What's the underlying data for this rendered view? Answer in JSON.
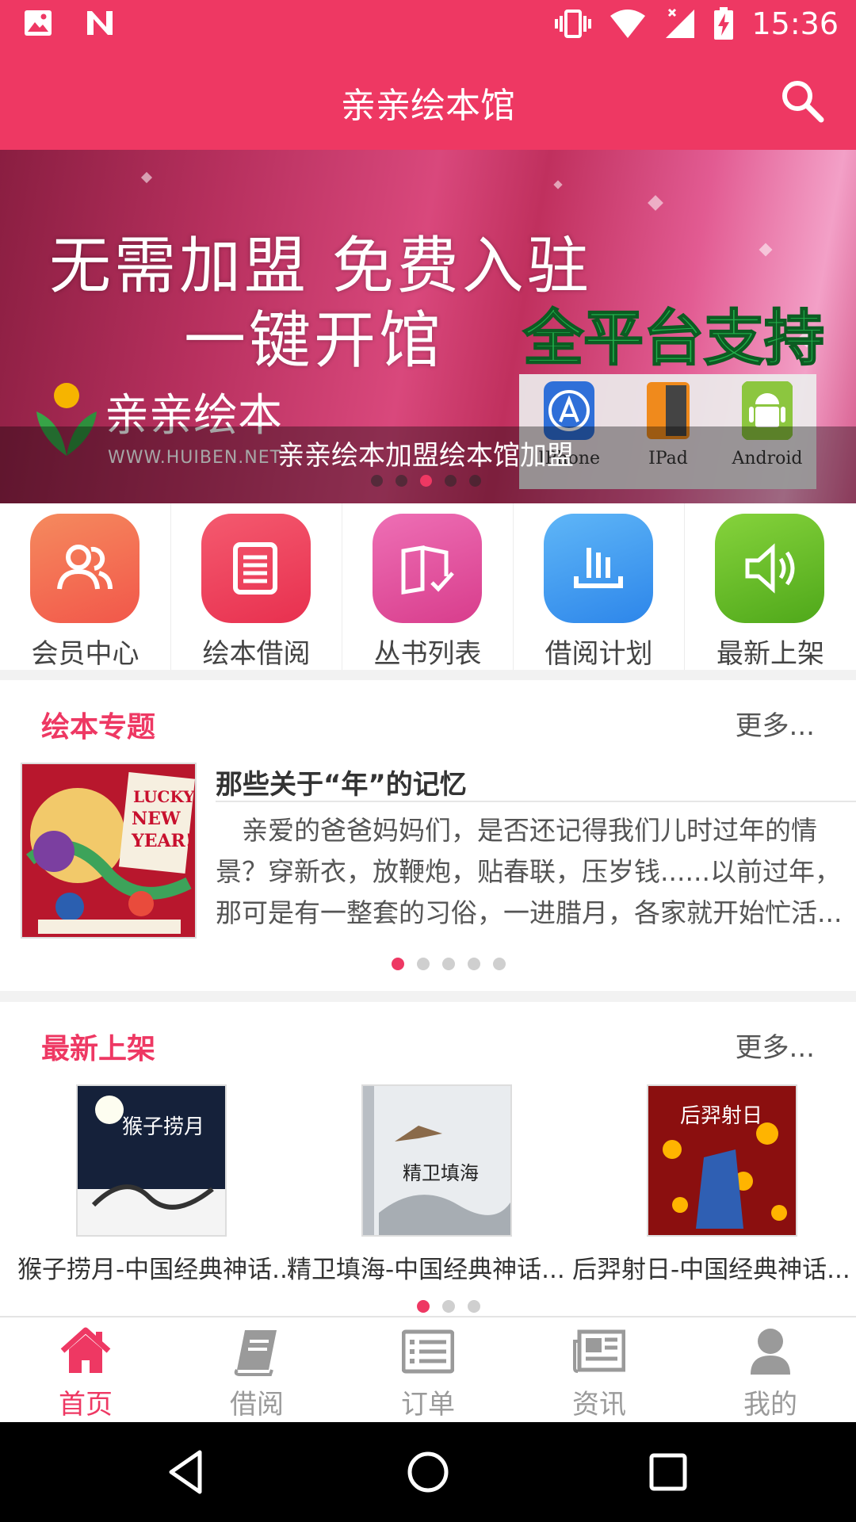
{
  "status_bar": {
    "time": "15:36",
    "left_icons": [
      "image-icon",
      "n-app-icon"
    ],
    "right_icons": [
      "vibrate-icon",
      "wifi-icon",
      "signal-icon",
      "battery-charging-icon"
    ]
  },
  "app_bar": {
    "title": "亲亲绘本馆",
    "search_icon": "search-icon"
  },
  "banner": {
    "headline_1": "无需加盟 免费入驻",
    "headline_2": "一键开馆",
    "platform_slogan": "全平台支持",
    "logo_text": "亲亲绘本",
    "logo_url": "WWW.HUIBEN.NET",
    "platforms": [
      "IPhone",
      "IPad",
      "Android"
    ],
    "caption": "亲亲绘本加盟绘本馆加盟",
    "active_dot": 3,
    "dot_count": 5
  },
  "nav_grid": [
    {
      "label": "会员中心",
      "icon": "members-icon",
      "color": "#f36f52"
    },
    {
      "label": "绘本借阅",
      "icon": "book-list-icon",
      "color": "#ee3c5f"
    },
    {
      "label": "丛书列表",
      "icon": "open-book-icon",
      "color": "#e0519d"
    },
    {
      "label": "借阅计划",
      "icon": "plan-icon",
      "color": "#3b9af1"
    },
    {
      "label": "最新上架",
      "icon": "speaker-icon",
      "color": "#66c025"
    }
  ],
  "topics": {
    "title": "绘本专题",
    "more": "更多...",
    "item_title": "那些关于“年”的记忆",
    "item_text": "　亲爱的爸爸妈妈们，是否还记得我们儿时过年的情景？穿新衣，放鞭炮，贴春联，压岁钱......以前过年，那可是有一整套的习俗，一进腊月，各家就开始忙活...",
    "cover_text": "LUCKY NEW YEAR!",
    "active_dot": 1,
    "dot_count": 5
  },
  "new_arrivals": {
    "title": "最新上架",
    "more": "更多...",
    "books": [
      {
        "caption": "猴子捞月-中国经典神话...",
        "cover_text": "猴子捞月"
      },
      {
        "caption": "精卫填海-中国经典神话...",
        "cover_text": "精卫填海"
      },
      {
        "caption": "后羿射日-中国经典神话...",
        "cover_text": "后羿射日"
      }
    ],
    "active_dot": 1,
    "dot_count": 3
  },
  "bottom_nav": [
    {
      "label": "首页",
      "icon": "home-icon",
      "active": true
    },
    {
      "label": "借阅",
      "icon": "borrow-book-icon",
      "active": false
    },
    {
      "label": "订单",
      "icon": "order-list-icon",
      "active": false
    },
    {
      "label": "资讯",
      "icon": "news-icon",
      "active": false
    },
    {
      "label": "我的",
      "icon": "profile-icon",
      "active": false
    }
  ],
  "colors": {
    "accent": "#ee3863",
    "inactive_tab": "#9a9a9a"
  }
}
